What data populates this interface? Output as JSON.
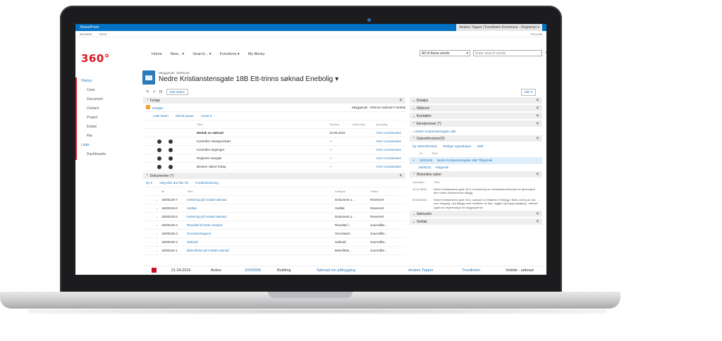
{
  "topbar": {
    "brand": "SharePoint",
    "user": "Anders Tapper (Trondheim Kommune - Registrar) ▾"
  },
  "subbar": {
    "browse": "BROWSE",
    "page": "PAGE",
    "follow": "FOLLOW"
  },
  "logo": "360°",
  "nav": {
    "items": [
      "Home",
      "New... ▾",
      "Search... ▾",
      "Functions ▾",
      "My library"
    ]
  },
  "search": {
    "scope": "All of these words",
    "placeholder": "Enter search words"
  },
  "leftnav": {
    "history": "History",
    "items": [
      "Case",
      "Document",
      "Contact",
      "Project",
      "Estate",
      "File"
    ],
    "links": "Links",
    "dashboards": "Dashboards"
  },
  "page": {
    "breadcrumb": "eByggesak: 16/00126",
    "title": "Nedre Kristianstensgate 18B Ett-trinns søknad Enebolig ▾",
    "set_status": "Sett status",
    "more": "Mer ▾"
  },
  "forlop": {
    "title": "Forløp",
    "detail": "Detaljer",
    "process": "eByggesak - Ettrinns søknad // Mottak",
    "actions": [
      "Lukk fasen",
      "Sett til pause",
      "Annet ▾"
    ],
    "cols": {
      "title": "Tittel",
      "deadline": "Tidsfrist",
      "finished": "Løftet dato",
      "responsible": "Ansvarlig"
    },
    "rows": [
      {
        "title": "Mottak av søknad",
        "deadline": "23.05.2016",
        "finished": "",
        "responsible": "Arne Cornelussen"
      },
      {
        "title": "Kontroller situasjonskart",
        "deadline": "---",
        "finished": "",
        "responsible": "Arne Cornelussen"
      },
      {
        "title": "Kontroller tegninger",
        "deadline": "---",
        "finished": "",
        "responsible": "Arne Cornelussen"
      },
      {
        "title": "Registrer mangler",
        "deadline": "---",
        "finished": "",
        "responsible": "Arne Cornelussen"
      },
      {
        "title": "Bestem videre forløp",
        "deadline": "---",
        "finished": "",
        "responsible": "Arne Cornelussen"
      }
    ]
  },
  "docs": {
    "title": "Dokumenter (*)",
    "actions": [
      "Ny ▾",
      "Velg eller dra filer hit",
      "Forhåndsvisning"
    ],
    "cols": {
      "no": "Nr.",
      "title": "Tittel",
      "category": "Kategori",
      "status": "Status"
    },
    "rows": [
      {
        "no": "16/00126-7",
        "title": "Kvittering på mottatt søknad",
        "category": "Dokument u...",
        "status": "Reservert"
      },
      {
        "no": "16/00126-6",
        "title": "Vedtak",
        "category": "Vedtak",
        "status": "Reservert"
      },
      {
        "no": "16/00126-5",
        "title": "Kvittering på mottatt søknad",
        "category": "Dokument u...",
        "status": "Reservert"
      },
      {
        "no": "16/00126-4",
        "title": "Resultat fra DOK analyse",
        "category": "Resultat f...",
        "status": "Journalfør..."
      },
      {
        "no": "16/00126-3",
        "title": "Grunnkartrapport",
        "category": "Grunnkartr...",
        "status": "Journalfør..."
      },
      {
        "no": "16/00126-2",
        "title": "Søknad",
        "category": "Søknad",
        "status": "Journalfør..."
      },
      {
        "no": "16/00126-1",
        "title": "Bekreftelse på mottatt søknad",
        "category": "Bekreftels...",
        "status": "Journalfør..."
      }
    ]
  },
  "right": {
    "panels": [
      "Detaljer",
      "Stikkord",
      "Kontakter"
    ],
    "eiendommer": "Eiendommer (*)",
    "eiendom_item": "Nedre Kristianstensgate 18B",
    "sakref": "Saksreferanser(3)",
    "sakref_actions": [
      "Ny saksreferanse",
      "Rediger egenskaper",
      "Slett"
    ],
    "sakref_cols": {
      "no": "Nr.",
      "title": "Tittel"
    },
    "sakref_rows": [
      {
        "no": "16/00126",
        "title": "Nedre Kristianstensgate 18B Tilbygmak"
      },
      {
        "no": "16/00131",
        "title": "Klagesak"
      }
    ],
    "historiske": "Historiske saker",
    "hist_cols": {
      "date": "Saksdato",
      "title": "Tittel"
    },
    "hist_rows": [
      {
        "date": "12.11.2013",
        "title": "Nedre Kristianstens gate 18 A, anmodning om forhåndskonferanse for tjeneregnd ifbm under eksisterende tilbygg"
      },
      {
        "date": "20.03.2013",
        "title": "Nedre Kristianstens gate 18 A, søknad om tillatelse til tilbygg / tiltak, rivning av tak over inngang, nytt tilbygg med utvidelse av bad, byggel og trappeoppgang - søknad også om dispensasjon fra byggegrense"
      }
    ],
    "bottom": [
      "Søknader",
      "Vedtak"
    ]
  },
  "statusrow": {
    "date": "21.04.2016",
    "state": "Active",
    "no": "16/00095",
    "type": "Building",
    "link": "Søknad om påbygging",
    "person": "Anders Tapper",
    "place": "Trondheim",
    "kind": "Vedtak - søknad"
  }
}
